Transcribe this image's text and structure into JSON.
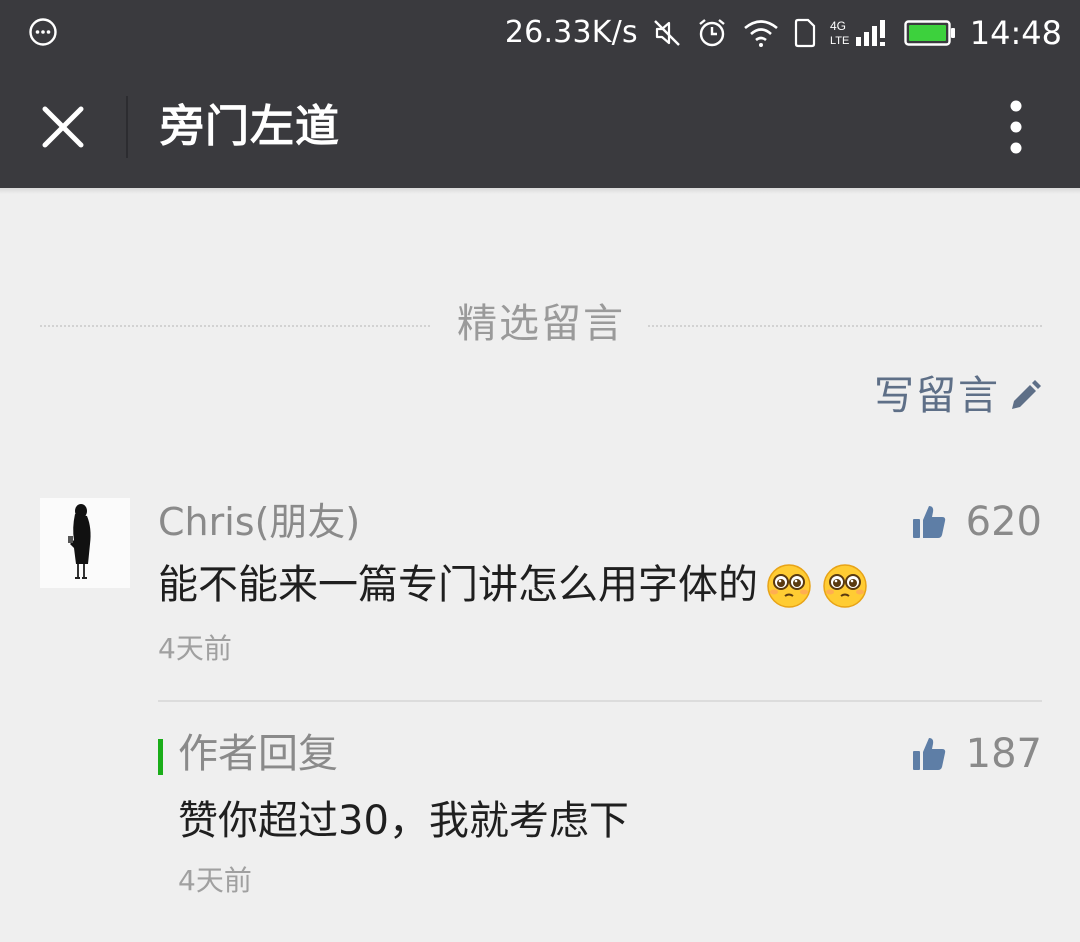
{
  "status_bar": {
    "network_speed": "26.33K/s",
    "time": "14:48",
    "icons": [
      "chat-bubble-icon",
      "mute-icon",
      "alarm-icon",
      "wifi-icon",
      "sim-icon",
      "4g-lte-icon",
      "signal-icon",
      "battery-icon"
    ],
    "network_type": "4G LTE"
  },
  "title_bar": {
    "title": "旁门左道",
    "close_icon": "close-icon",
    "more_icon": "more-vertical-icon",
    "background": "#3a3a3e"
  },
  "section": {
    "title": "精选留言"
  },
  "write_comment": {
    "label": "写留言",
    "icon": "pencil-icon",
    "color": "#5e6f87"
  },
  "comment": {
    "nickname": "Chris(朋友)",
    "text": "能不能来一篇专门讲怎么用字体的",
    "emojis": [
      "pleading-face-emoji",
      "pleading-face-emoji"
    ],
    "time": "4天前",
    "likes": "620"
  },
  "reply": {
    "label": "作者回复",
    "text": "赞你超过30，我就考虑下",
    "time": "4天前",
    "likes": "187",
    "accent_color": "#1aad19"
  },
  "colors": {
    "like_icon": "#5e7ea6",
    "muted_text": "#8a8a8a",
    "page_background": "#efefef"
  }
}
